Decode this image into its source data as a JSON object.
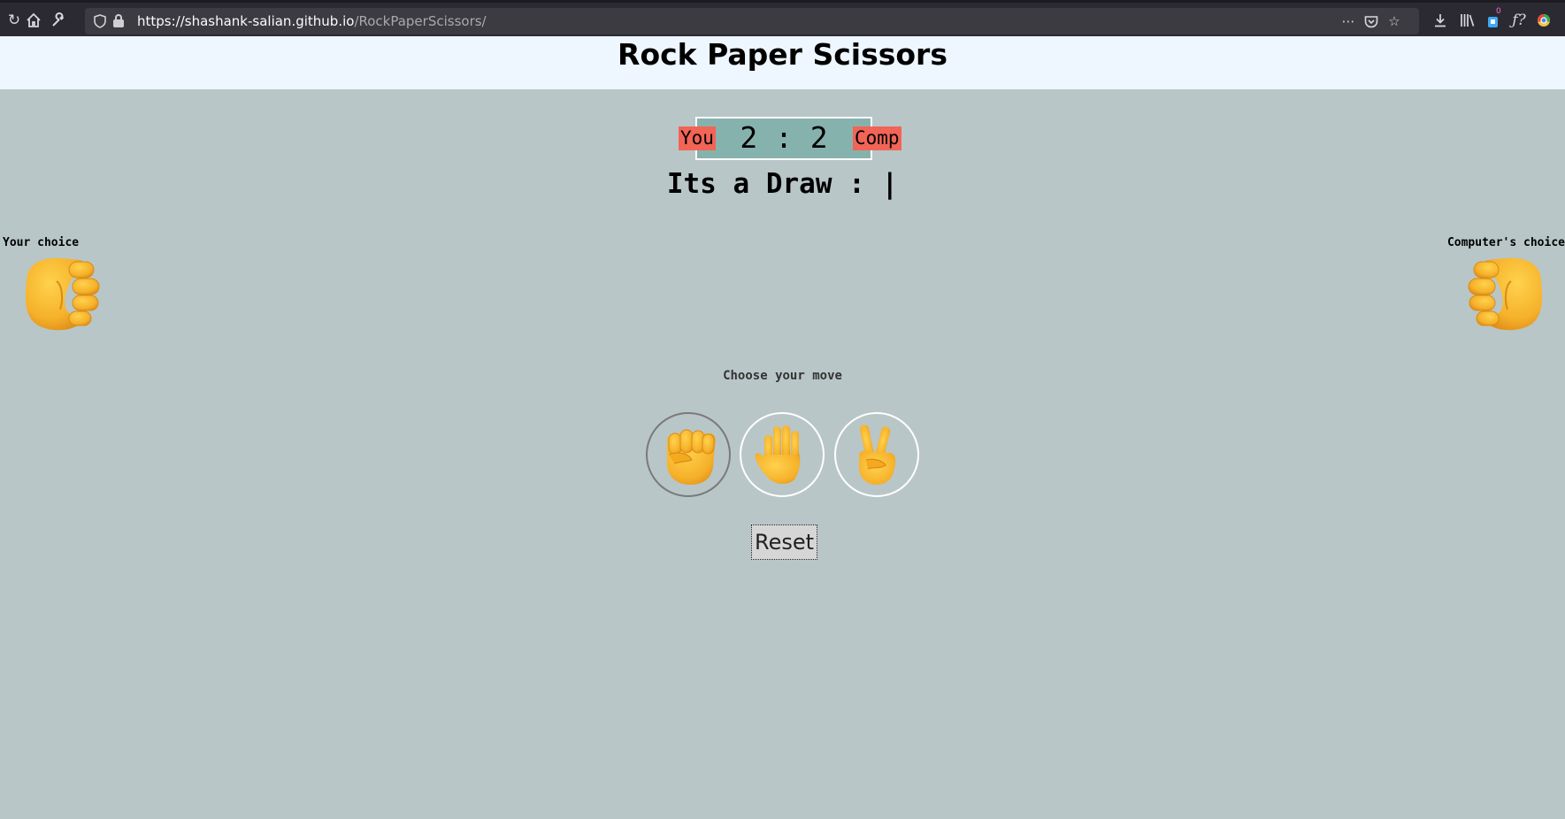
{
  "browser": {
    "url_host": "https://shashank-salian.github.io",
    "url_path": "/RockPaperScissors/",
    "notification_count": "0"
  },
  "page": {
    "title": "Rock Paper Scissors"
  },
  "score": {
    "you_label": "You",
    "comp_label": "Comp",
    "text": "2 : 2",
    "you": 2,
    "comp": 2
  },
  "result": {
    "text": "Its a Draw : |"
  },
  "choices": {
    "your_label": "Your choice",
    "computer_label": "Computer's choice",
    "your_choice_icon": "fist-icon",
    "computer_choice_icon": "fist-icon"
  },
  "moves": {
    "prompt": "Choose your move",
    "items": [
      "rock",
      "paper",
      "scissors"
    ],
    "selected": "rock"
  },
  "reset": {
    "label": "Reset"
  },
  "colors": {
    "page_bg": "#b9c6c7",
    "header_bg": "#eef7ff",
    "score_bg": "#86b2ae",
    "badge_bg": "#f26456",
    "emoji_yellow": "#f7b62a"
  }
}
